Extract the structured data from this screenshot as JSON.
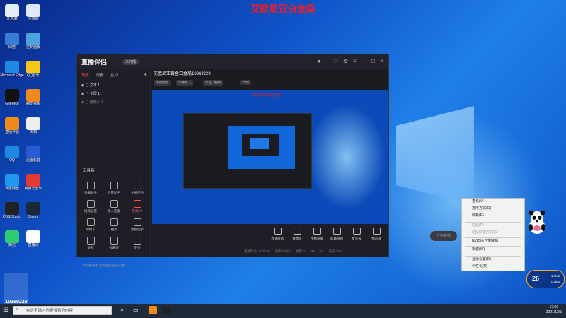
{
  "banner_title": "艾欧尼亚白金局",
  "desktop": {
    "icons": [
      "此电脑",
      "回收站",
      "网络",
      "控制面板",
      "Microsoft Edge",
      "QQ音乐",
      "GeForce",
      "腾讯视频",
      "直播伴侣",
      "文档",
      "QQ",
      "迅雷影音",
      "百度网盘",
      "网易云音乐",
      "OBS Studio",
      "Steam",
      "微信",
      "直播间"
    ]
  },
  "app": {
    "logo": "直播伴侣",
    "status_tag": "未开播",
    "left_tabs": [
      "场景",
      "观看",
      "互动"
    ],
    "sources": [
      "文本 1",
      "全屏 1",
      "摄像头 1"
    ],
    "tools_title": "工具箱",
    "tools": [
      "弹幕助手",
      "房管助手",
      "主播任务",
      "推流设置",
      "多人连麦",
      "连线PK",
      "购物车",
      "抽奖",
      "数据助手",
      "录制",
      "弹幕姬",
      "更多"
    ],
    "hint": "如何把手机游戏连接画面开播?",
    "room_title": "艾欧尼亚黄金白金局10369229",
    "head_tags": [
      "英雄联盟",
      "大神带飞",
      "公告 · 编辑"
    ],
    "viewers": "2206",
    "preview_overlay_text": "艾欧尼亚白金局",
    "bottom_items": [
      "直播画面",
      "摄像头",
      "手机投屏",
      "屏幕画面",
      "麦克风",
      "扬声器"
    ],
    "start_label": "开始直播",
    "stats": "直播时长 00:00:00 　 码率 0kbps 　 帧率 0 　 CPU 12% 　 内存 36%"
  },
  "context_menu": {
    "items": [
      "查看(V)",
      "排序方式(O)",
      "刷新(E)",
      "粘贴(P)",
      "粘贴快捷方式(S)",
      "NVIDIA 控制面板",
      "新建(W)",
      "显示设置(D)",
      "个性化(R)"
    ],
    "disabled": [
      "粘贴(P)",
      "粘贴快捷方式(S)"
    ]
  },
  "weather": {
    "temp": "26",
    "speed_up": "1.7k/s",
    "speed_down": "0.2k/s"
  },
  "room_id": "10369229",
  "taskbar": {
    "search_placeholder": "在这里输入你要搜索的内容",
    "time": "17:50",
    "date": "2021/12/5"
  },
  "colors": {
    "brand_red": "#e81f2a",
    "desktop_blue": "#0f52c8"
  }
}
